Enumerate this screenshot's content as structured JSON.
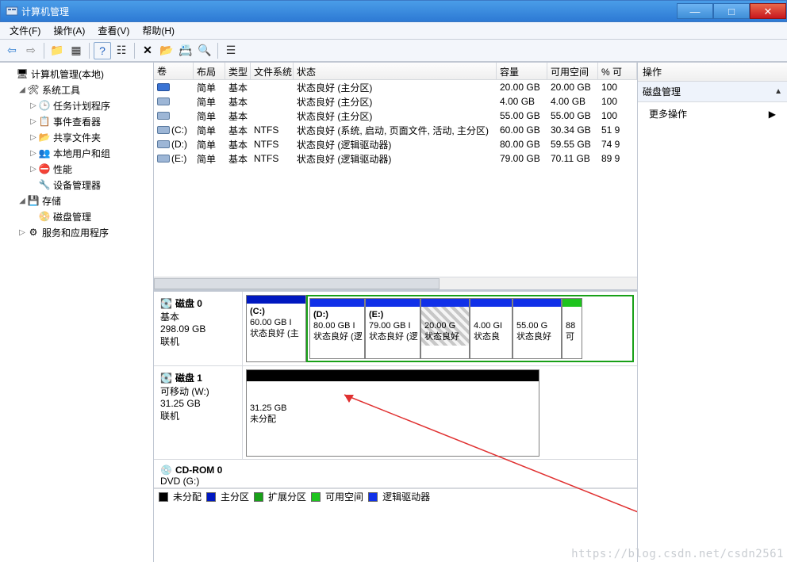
{
  "window": {
    "title": "计算机管理",
    "buttons": {
      "min": "—",
      "max": "□",
      "close": "✕"
    }
  },
  "menu": {
    "file": "文件(F)",
    "action": "操作(A)",
    "view": "查看(V)",
    "help": "帮助(H)"
  },
  "toolbar_icons": {
    "back": "⇦",
    "fwd": "⇨",
    "up": "📁",
    "views": "▦",
    "help": "?",
    "sheet": "☷",
    "delete": "✕",
    "open": "📂",
    "props": "📇",
    "find": "🔍",
    "ext": "☰"
  },
  "tree": {
    "root": "计算机管理(本地)",
    "systools": "系统工具",
    "scheduler": "任务计划程序",
    "eventviewer": "事件查看器",
    "shared": "共享文件夹",
    "users": "本地用户和组",
    "perf": "性能",
    "devmgr": "设备管理器",
    "storage": "存储",
    "diskmgmt": "磁盘管理",
    "services": "服务和应用程序"
  },
  "vol_headers": {
    "vol": "卷",
    "layout": "布局",
    "type": "类型",
    "fs": "文件系统",
    "status": "状态",
    "cap": "容量",
    "free": "可用空间",
    "pct": "% 可"
  },
  "volumes": [
    {
      "name": "",
      "sel": true,
      "layout": "简单",
      "type": "基本",
      "fs": "",
      "status": "状态良好 (主分区)",
      "cap": "20.00 GB",
      "free": "20.00 GB",
      "pct": "100"
    },
    {
      "name": "",
      "layout": "简单",
      "type": "基本",
      "fs": "",
      "status": "状态良好 (主分区)",
      "cap": "4.00 GB",
      "free": "4.00 GB",
      "pct": "100"
    },
    {
      "name": "",
      "layout": "简单",
      "type": "基本",
      "fs": "",
      "status": "状态良好 (主分区)",
      "cap": "55.00 GB",
      "free": "55.00 GB",
      "pct": "100"
    },
    {
      "name": "(C:)",
      "layout": "简单",
      "type": "基本",
      "fs": "NTFS",
      "status": "状态良好 (系统, 启动, 页面文件, 活动, 主分区)",
      "cap": "60.00 GB",
      "free": "30.34 GB",
      "pct": "51 9"
    },
    {
      "name": "(D:)",
      "layout": "简单",
      "type": "基本",
      "fs": "NTFS",
      "status": "状态良好 (逻辑驱动器)",
      "cap": "80.00 GB",
      "free": "59.55 GB",
      "pct": "74 9"
    },
    {
      "name": "(E:)",
      "layout": "简单",
      "type": "基本",
      "fs": "NTFS",
      "status": "状态良好 (逻辑驱动器)",
      "cap": "79.00 GB",
      "free": "70.11 GB",
      "pct": "89 9"
    }
  ],
  "disk0": {
    "name": "磁盘 0",
    "type": "基本",
    "size": "298.09 GB",
    "status": "联机",
    "c": {
      "label": "(C:)",
      "size": "60.00 GB I",
      "status": "状态良好 (主"
    },
    "d": {
      "label": "(D:)",
      "size": "80.00 GB I",
      "status": "状态良好 (逻"
    },
    "e": {
      "label": "(E:)",
      "size": "79.00 GB I",
      "status": "状态良好 (逻"
    },
    "p20": {
      "size": "20.00 G",
      "status": "状态良好"
    },
    "p4": {
      "size": "4.00 GI",
      "status": "状态良"
    },
    "p55": {
      "size": "55.00 G",
      "status": "状态良好"
    },
    "free": {
      "size": "88",
      "status": "可"
    }
  },
  "disk1": {
    "name": "磁盘 1",
    "type": "可移动 (W:)",
    "size": "31.25 GB",
    "status": "联机",
    "unalloc": {
      "size": "31.25 GB",
      "status": "未分配"
    }
  },
  "cdrom": {
    "name": "CD-ROM 0",
    "type": "DVD (G:)"
  },
  "legend": {
    "unalloc": "未分配",
    "primary": "主分区",
    "ext": "扩展分区",
    "free": "可用空间",
    "logical": "逻辑驱动器"
  },
  "actions": {
    "header": "操作",
    "section": "磁盘管理",
    "more": "更多操作"
  },
  "watermark": "https://blog.csdn.net/csdn2561"
}
